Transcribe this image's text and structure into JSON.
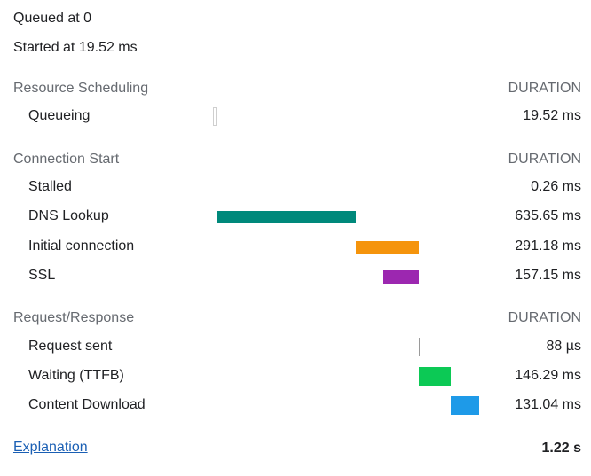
{
  "header": {
    "queued": "Queued at 0",
    "started": "Started at 19.52 ms"
  },
  "sections": [
    {
      "title": "Resource Scheduling",
      "duration_label": "DURATION",
      "rows": [
        {
          "label": "Queueing",
          "duration": "19.52 ms"
        }
      ]
    },
    {
      "title": "Connection Start",
      "duration_label": "DURATION",
      "rows": [
        {
          "label": "Stalled",
          "duration": "0.26 ms"
        },
        {
          "label": "DNS Lookup",
          "duration": "635.65 ms",
          "color": "#00897b"
        },
        {
          "label": "Initial connection",
          "duration": "291.18 ms",
          "color": "#f5940c"
        },
        {
          "label": "SSL",
          "duration": "157.15 ms",
          "color": "#9c27b0"
        }
      ]
    },
    {
      "title": "Request/Response",
      "duration_label": "DURATION",
      "rows": [
        {
          "label": "Request sent",
          "duration": "88 µs"
        },
        {
          "label": "Waiting (TTFB)",
          "duration": "146.29 ms",
          "color": "#0cc955"
        },
        {
          "label": "Content Download",
          "duration": "131.04 ms",
          "color": "#1e9ae8"
        }
      ]
    }
  ],
  "footer": {
    "explanation_link": "Explanation",
    "total": "1.22 s"
  }
}
